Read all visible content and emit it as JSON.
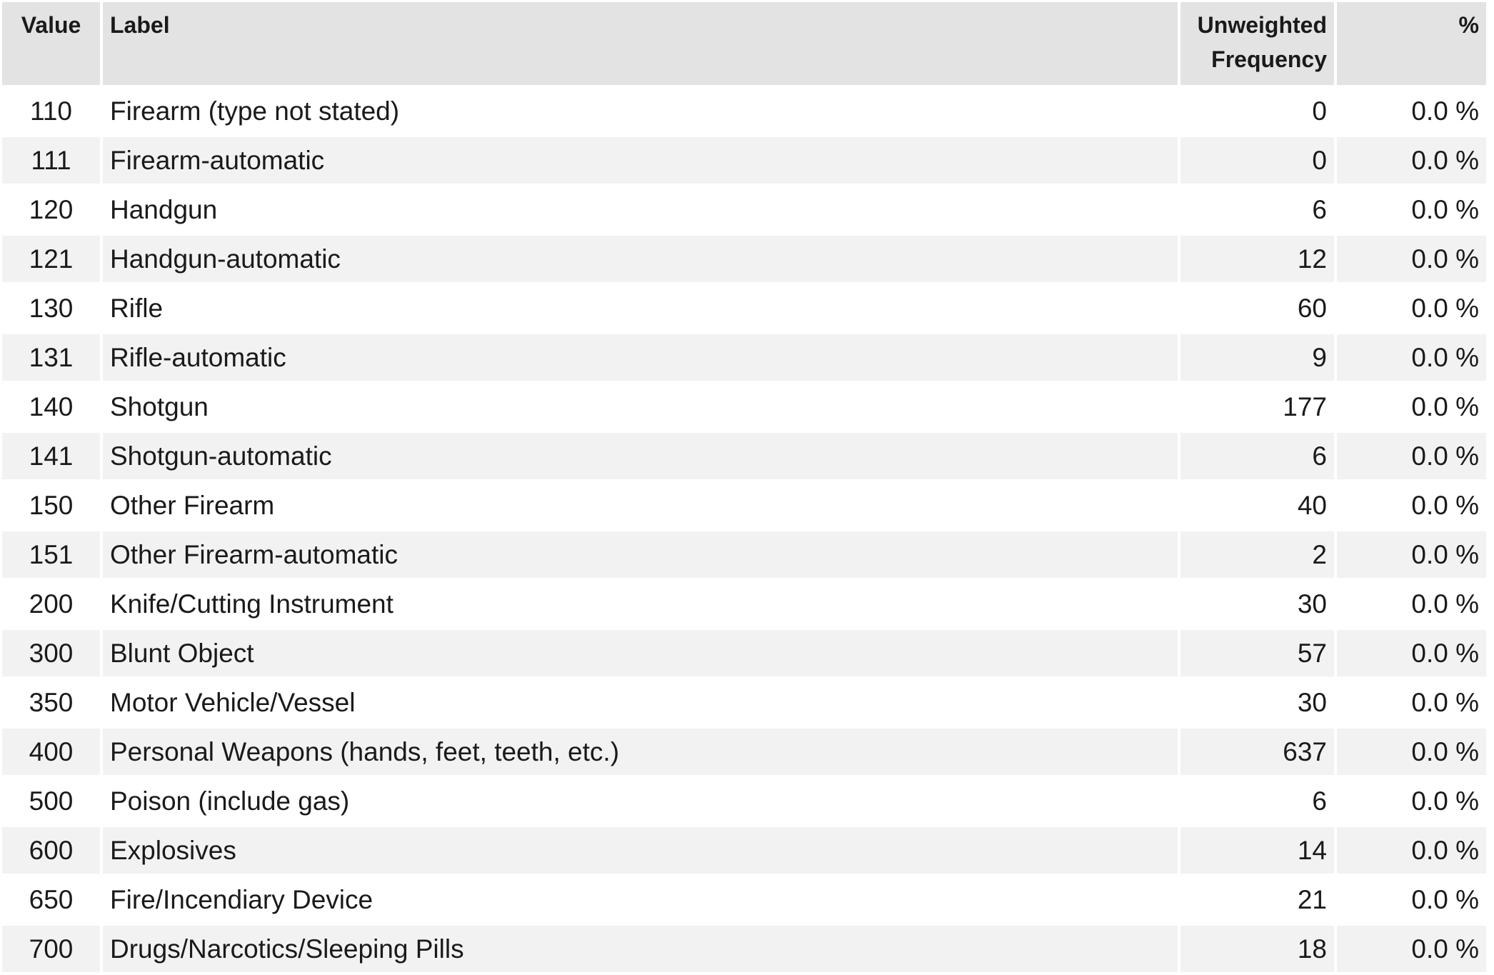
{
  "table": {
    "headers": {
      "value": "Value",
      "label": "Label",
      "freq_line1": "Unweighted",
      "freq_line2": "Frequency",
      "pct": "%"
    },
    "rows": [
      {
        "value": "110",
        "label": "Firearm (type not stated)",
        "freq": "0",
        "pct": "0.0 %"
      },
      {
        "value": "111",
        "label": "Firearm-automatic",
        "freq": "0",
        "pct": "0.0 %"
      },
      {
        "value": "120",
        "label": "Handgun",
        "freq": "6",
        "pct": "0.0 %"
      },
      {
        "value": "121",
        "label": "Handgun-automatic",
        "freq": "12",
        "pct": "0.0 %"
      },
      {
        "value": "130",
        "label": "Rifle",
        "freq": "60",
        "pct": "0.0 %"
      },
      {
        "value": "131",
        "label": "Rifle-automatic",
        "freq": "9",
        "pct": "0.0 %"
      },
      {
        "value": "140",
        "label": "Shotgun",
        "freq": "177",
        "pct": "0.0 %"
      },
      {
        "value": "141",
        "label": "Shotgun-automatic",
        "freq": "6",
        "pct": "0.0 %"
      },
      {
        "value": "150",
        "label": "Other Firearm",
        "freq": "40",
        "pct": "0.0 %"
      },
      {
        "value": "151",
        "label": "Other Firearm-automatic",
        "freq": "2",
        "pct": "0.0 %"
      },
      {
        "value": "200",
        "label": "Knife/Cutting Instrument",
        "freq": "30",
        "pct": "0.0 %"
      },
      {
        "value": "300",
        "label": "Blunt Object",
        "freq": "57",
        "pct": "0.0 %"
      },
      {
        "value": "350",
        "label": "Motor Vehicle/Vessel",
        "freq": "30",
        "pct": "0.0 %"
      },
      {
        "value": "400",
        "label": "Personal Weapons (hands, feet, teeth, etc.)",
        "freq": "637",
        "pct": "0.0 %"
      },
      {
        "value": "500",
        "label": "Poison (include gas)",
        "freq": "6",
        "pct": "0.0 %"
      },
      {
        "value": "600",
        "label": "Explosives",
        "freq": "14",
        "pct": "0.0 %"
      },
      {
        "value": "650",
        "label": "Fire/Incendiary Device",
        "freq": "21",
        "pct": "0.0 %"
      },
      {
        "value": "700",
        "label": "Drugs/Narcotics/Sleeping Pills",
        "freq": "18",
        "pct": "0.0 %"
      }
    ]
  }
}
